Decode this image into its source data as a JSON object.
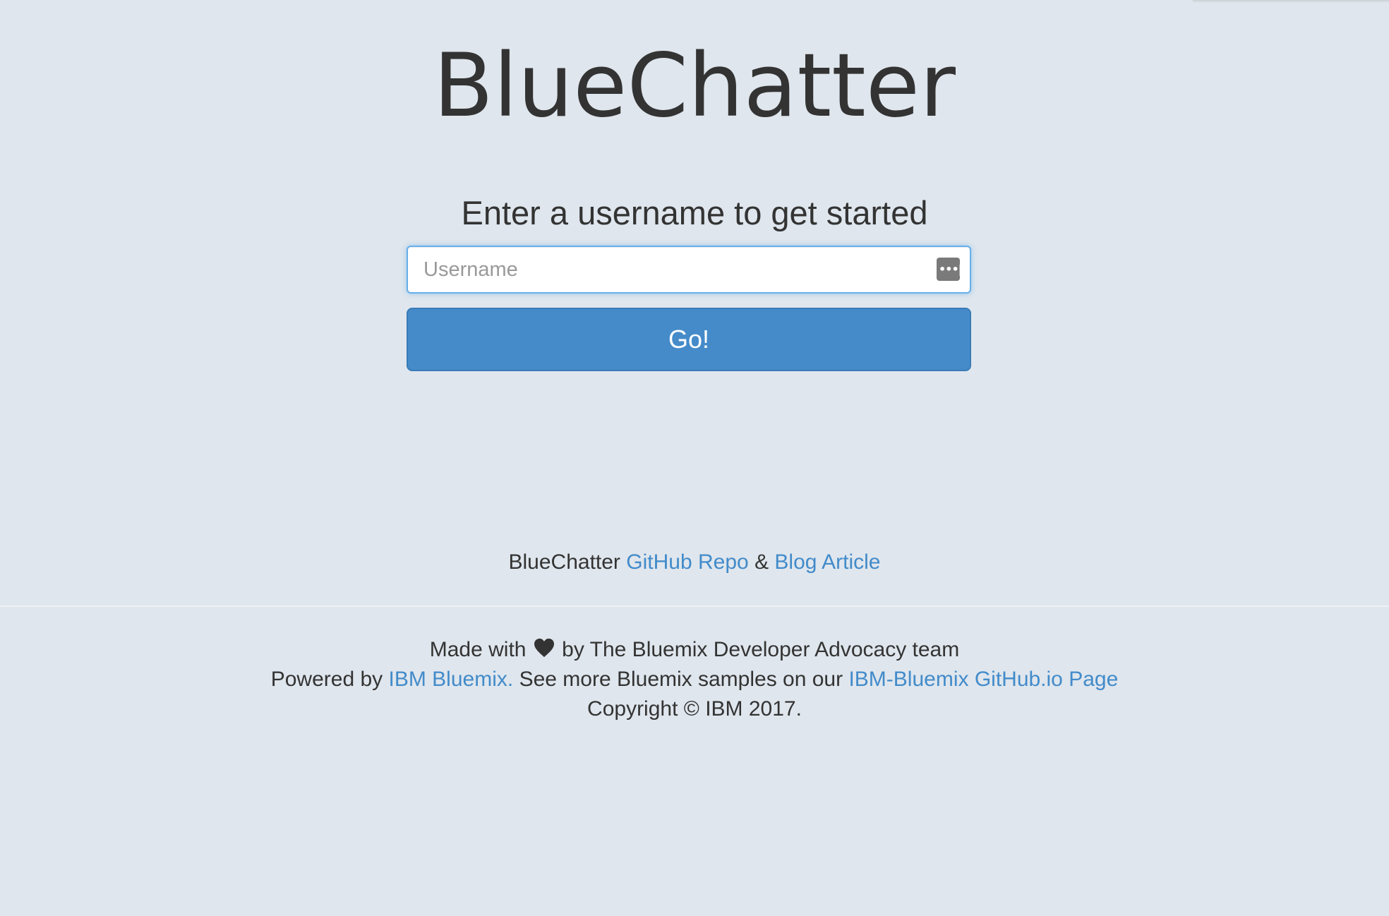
{
  "app": {
    "title": "BlueChatter"
  },
  "login": {
    "prompt": "Enter a username to get started",
    "username_placeholder": "Username",
    "username_value": "",
    "go_label": "Go!"
  },
  "links": {
    "prefix": "BlueChatter",
    "github_repo": "GitHub Repo",
    "separator": "&",
    "blog_article": "Blog Article"
  },
  "footer": {
    "made_with": "Made with",
    "by_team": "by The Bluemix Developer Advocacy team",
    "powered_by": "Powered by",
    "ibm_bluemix": "IBM Bluemix.",
    "see_more": "See more Bluemix samples on our",
    "github_io_page": "IBM-Bluemix GitHub.io Page",
    "copyright": "Copyright © IBM 2017."
  },
  "icons": {
    "heart": "heart-icon",
    "keychain": "keychain-icon"
  },
  "colors": {
    "background": "#dfe6ed",
    "accent": "#458bc9",
    "link": "#428bca",
    "text": "#333333"
  }
}
